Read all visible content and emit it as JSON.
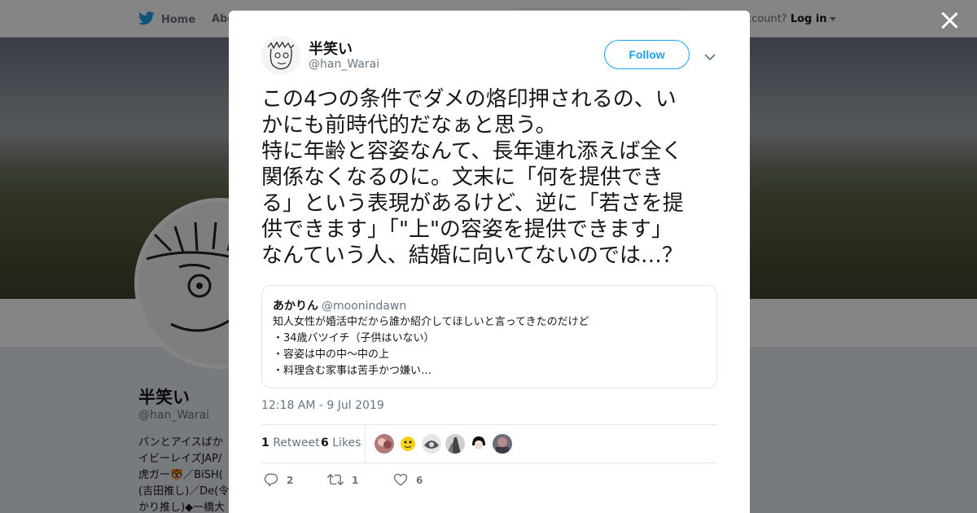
{
  "topbar": {
    "home_label": "Home",
    "about_label": "Abo",
    "account_prompt": "account?",
    "login_label": "Log in"
  },
  "profile": {
    "name": "半笑い",
    "handle": "@han_Warai",
    "bio_lines": [
      "パンとアイスばか",
      "イビーレイズJAP/",
      "虎ガー🐯／BiSH(",
      "(吉田推し)／De(令",
      "かり推し)◆一橋大"
    ]
  },
  "tweet": {
    "author_name": "半笑い",
    "author_handle": "@han_Warai",
    "follow_label": "Follow",
    "text_lines": [
      "この4つの条件でダメの烙印押されるの、い",
      "かにも前時代的だなぁと思う。",
      "特に年齢と容姿なんて、長年連れ添えば全く",
      "関係なくなるのに。文末に「何を提供でき",
      "る」という表現があるけど、逆に「若さを提",
      "供できます」「\"上\"の容姿を提供できます」",
      "なんていう人、結婚に向いてないのでは…？"
    ],
    "quoted": {
      "name": "あかりん",
      "handle": "@moonindawn",
      "lines": [
        "知人女性が婚活中だから誰か紹介してほしいと言ってきたのだけど",
        "・34歳バツイチ（子供はいない）",
        "・容姿は中の中〜中の上",
        "・料理含む家事は苦手かつ嫌い…"
      ]
    },
    "timestamp": "12:18 AM - 9 Jul 2019",
    "retweet_count": "1",
    "retweet_label": "Retweet",
    "like_count": "6",
    "like_label": "Likes",
    "actions": {
      "reply_count": "2",
      "retweet_count": "1",
      "like_count": "6"
    }
  },
  "colors": {
    "accent": "#1da1f2",
    "text_primary": "#14171a",
    "text_secondary": "#657786",
    "border": "#e1e8ed"
  },
  "icons": [
    "twitter-bird-icon",
    "close-icon",
    "chevron-down-icon",
    "reply-icon",
    "retweet-icon",
    "heart-icon"
  ]
}
